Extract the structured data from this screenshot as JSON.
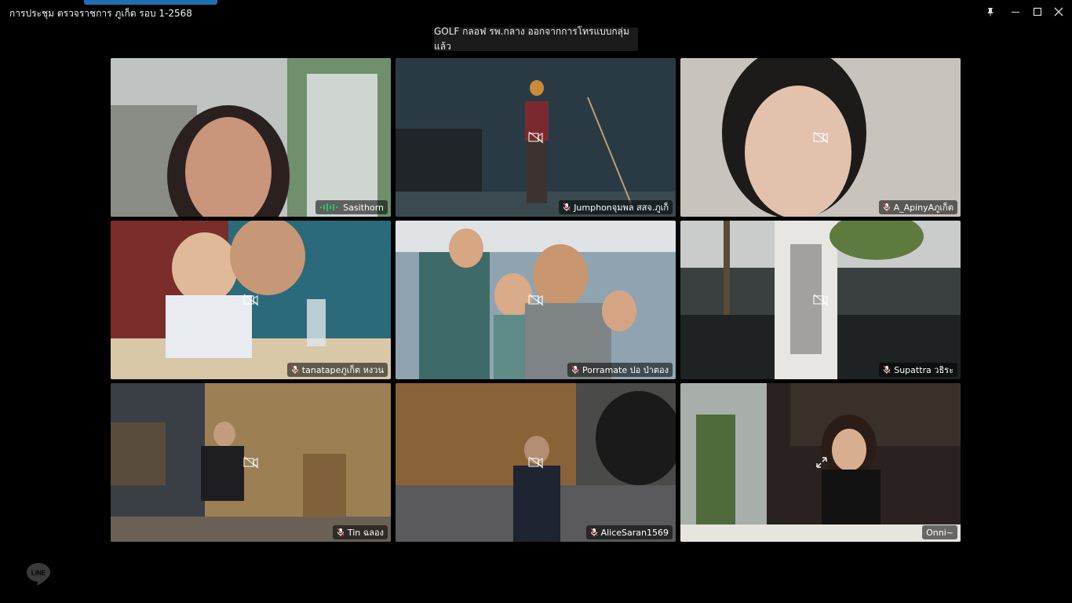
{
  "window": {
    "title": "การประชุม ตรวจราชการ ภูเก็ต รอบ 1-2568"
  },
  "notification": "GOLF กลอฟ รพ.กลาง ออกจากการโทรแบบกลุ่มแล้ว",
  "participants": [
    {
      "name": "Sasithorn",
      "status": "speaking",
      "active": true
    },
    {
      "name": "Jumphonจุมพล สสจ.ภูเก็",
      "status": "muted"
    },
    {
      "name": "A_ApinyAภูเก็ต",
      "status": "muted"
    },
    {
      "name": "tanatapeภูเก็ต หงวน",
      "status": "muted"
    },
    {
      "name": "Porramate ปอ ป่าตอง",
      "status": "muted"
    },
    {
      "name": "Supattra วธิระ",
      "status": "muted"
    },
    {
      "name": "Tin ฉลอง",
      "status": "muted"
    },
    {
      "name": "AliceSaran1569",
      "status": "muted"
    },
    {
      "name": "Onni~",
      "status": "unmuted"
    }
  ],
  "brand": "LINE",
  "colors": {
    "active_border": "#2ec266",
    "accent": "#1f6fb5"
  }
}
